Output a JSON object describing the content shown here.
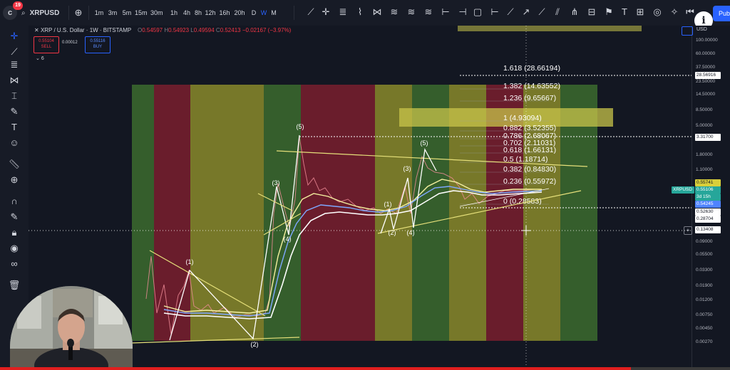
{
  "topbar": {
    "notification_count": "19",
    "symbol": "XRPUSD",
    "intervals": [
      "1m",
      "3m",
      "5m",
      "15m",
      "30m",
      "1h",
      "4h",
      "8h",
      "12h",
      "16h",
      "20h",
      "D",
      "W",
      "M"
    ],
    "active_interval": "W",
    "publish_label": "Pub"
  },
  "legend": {
    "title": "XRP / U.S. Dollar · 1W · BITSTAMP",
    "o_label": "O",
    "o": "0.54597",
    "h_label": "H",
    "h": "0.54923",
    "l_label": "L",
    "l": "0.49594",
    "c_label": "C",
    "c": "0.52413",
    "change": "−0.02167 (−3.97%)"
  },
  "trade": {
    "sell_price": "0.55104",
    "sell_label": "SELL",
    "spread": "0.00012",
    "buy_price": "0.55116",
    "buy_label": "BUY",
    "indicator_count": "6"
  },
  "price_scale": {
    "currency": "USD",
    "ticks": [
      "100.00000",
      "60.00000",
      "37.50000",
      "23.50000",
      "14.50000",
      "8.50000",
      "5.00000",
      "3.00000",
      "1.80000",
      "1.10000",
      "0.65000",
      "0.38000",
      "0.22000",
      "0.09000",
      "0.05500",
      "0.03300",
      "0.01900",
      "0.01200",
      "0.00750",
      "0.00450",
      "0.00270"
    ],
    "badge_fib": "28.56916",
    "badge_level": "3.31700",
    "badge_yellow": "0.55741",
    "badge_symbol": "XRPUSD",
    "badge_price": "0.55106",
    "badge_countdown": "3d 15h",
    "badge_blue": "0.54245",
    "badge_white1": "0.52630",
    "badge_white2": "0.28704",
    "badge_cross": "0.13408"
  },
  "fib_levels": [
    {
      "ratio": "1.618",
      "value": "(28.66194)"
    },
    {
      "ratio": "1.382",
      "value": "(14.63552)"
    },
    {
      "ratio": "1.236",
      "value": "(9.65667)"
    },
    {
      "ratio": "1",
      "value": "(4.93094)"
    },
    {
      "ratio": "0.882",
      "value": "(3.52355)"
    },
    {
      "ratio": "0.786",
      "value": "(2.68067)"
    },
    {
      "ratio": "0.702",
      "value": "(2.11031)"
    },
    {
      "ratio": "0.618",
      "value": "(1.66131)"
    },
    {
      "ratio": "0.5",
      "value": "(1.18714)"
    },
    {
      "ratio": "0.382",
      "value": "(0.84830)"
    },
    {
      "ratio": "0.236",
      "value": "(0.55972)"
    },
    {
      "ratio": "0",
      "value": "(0.28583)"
    }
  ],
  "wave_labels": [
    "(1)",
    "(2)",
    "(3)",
    "(4)",
    "(5)",
    "(1)",
    "(2)",
    "(3)",
    "(4)",
    "(5)"
  ],
  "colors": {
    "bg": "#131722",
    "green_band": "#3c6b2e",
    "red_band": "#7a1e2e",
    "yellow_band": "#8a8a2a",
    "highlight": "#c8c44a",
    "accent_blue": "#2962ff",
    "down_red": "#f23645"
  }
}
